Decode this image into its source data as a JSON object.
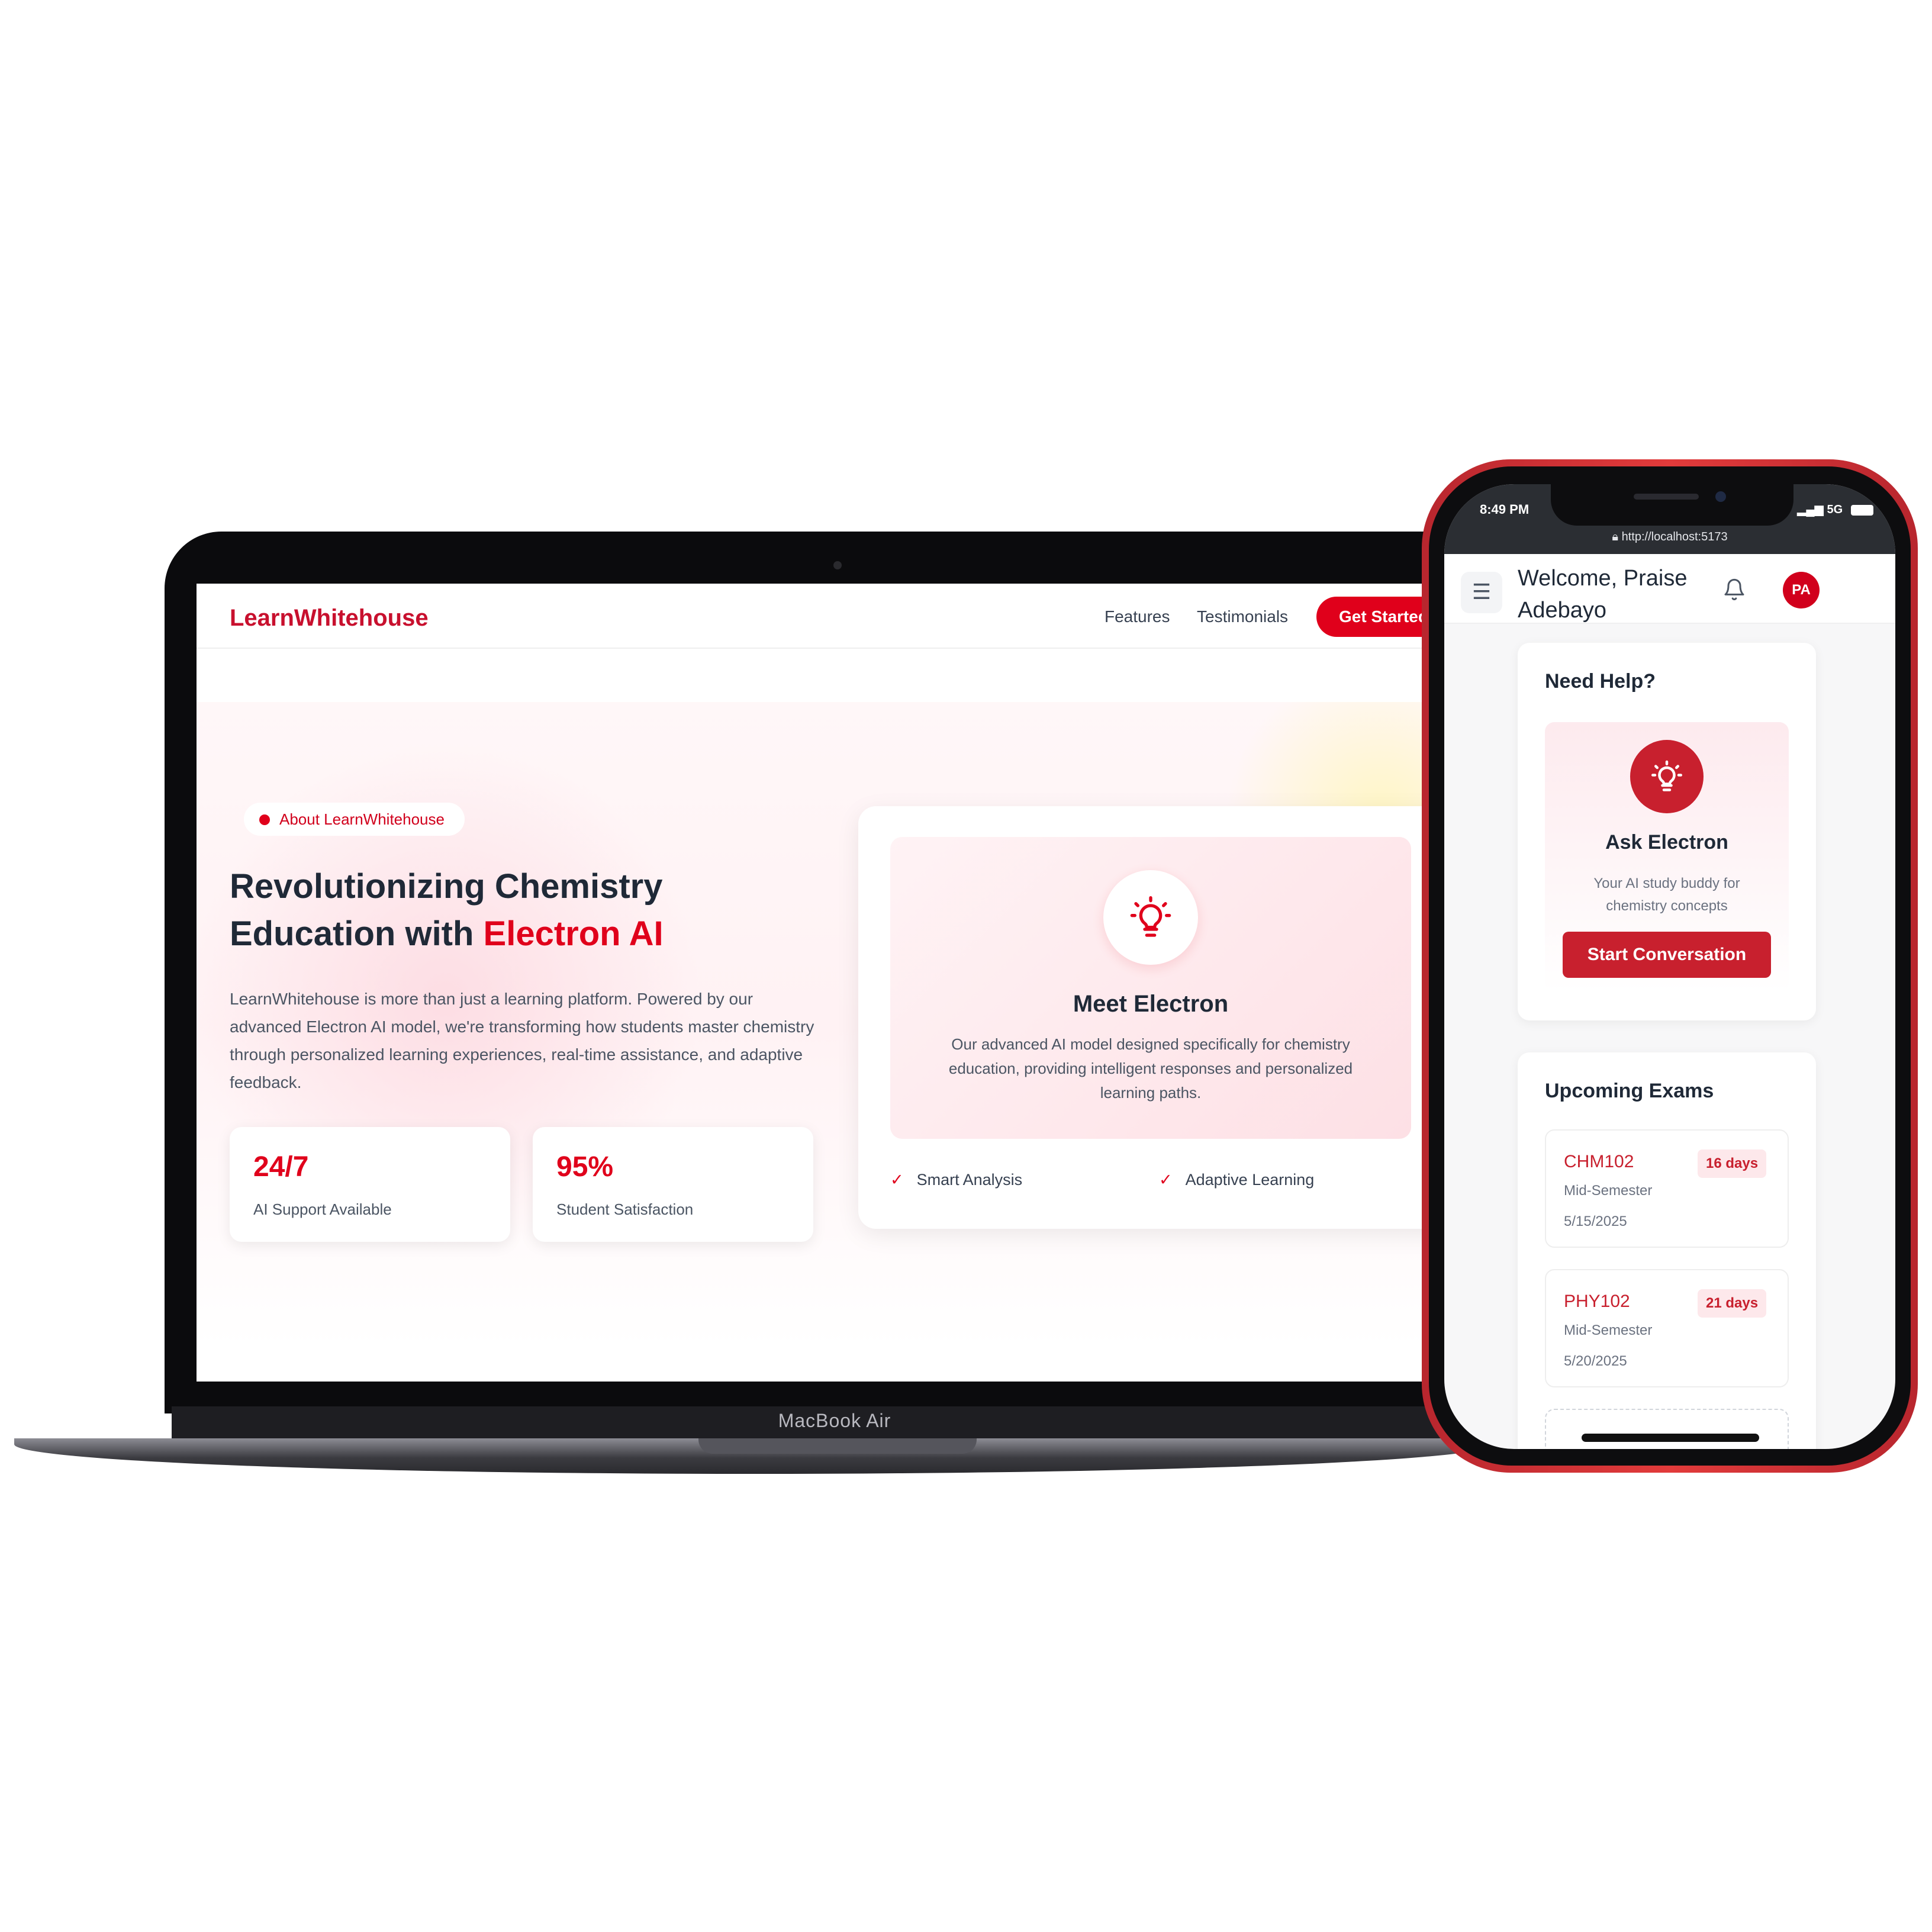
{
  "laptop": {
    "brand": "MacBook Air"
  },
  "site": {
    "logo": "LearnWhitehouse",
    "nav": {
      "features": "Features",
      "testimonials": "Testimonials",
      "cta": "Get Started"
    },
    "hero": {
      "badge": "About LearnWhitehouse",
      "title_line1": "Revolutionizing Chemistry",
      "title_line2_prefix": "Education with ",
      "title_accent": "Electron AI",
      "description": "LearnWhitehouse is more than just a learning platform. Powered by our advanced Electron AI model, we're transforming how students master chemistry through personalized learning experiences, real-time assistance, and adaptive feedback.",
      "stats": [
        {
          "value": "24/7",
          "label": "AI Support Available"
        },
        {
          "value": "95%",
          "label": "Student Satisfaction"
        }
      ]
    },
    "electron_card": {
      "icon": "lightbulb-icon",
      "title": "Meet Electron",
      "description": "Our advanced AI model designed specifically for chemistry education, providing intelligent responses and personalized learning paths.",
      "features": [
        "Smart Analysis",
        "Adaptive Learning"
      ]
    }
  },
  "phone": {
    "status": {
      "time": "8:49 PM",
      "signal": "5G",
      "url": "http://localhost:5173"
    },
    "header": {
      "welcome": "Welcome, Praise Adebayo",
      "avatar_initials": "PA"
    },
    "help": {
      "title": "Need Help?",
      "card_title": "Ask Electron",
      "description": "Your AI study buddy for chemistry concepts",
      "button": "Start Conversation"
    },
    "exams": {
      "title": "Upcoming Exams",
      "items": [
        {
          "code": "CHM102",
          "type": "Mid-Semester",
          "date": "5/15/2025",
          "countdown": "16 days"
        },
        {
          "code": "PHY102",
          "type": "Mid-Semester",
          "date": "5/20/2025",
          "countdown": "21 days"
        }
      ]
    }
  },
  "colors": {
    "brand_red": "#e0001b",
    "phone_frame": "#d42f33",
    "text_dark": "#1f2937"
  }
}
